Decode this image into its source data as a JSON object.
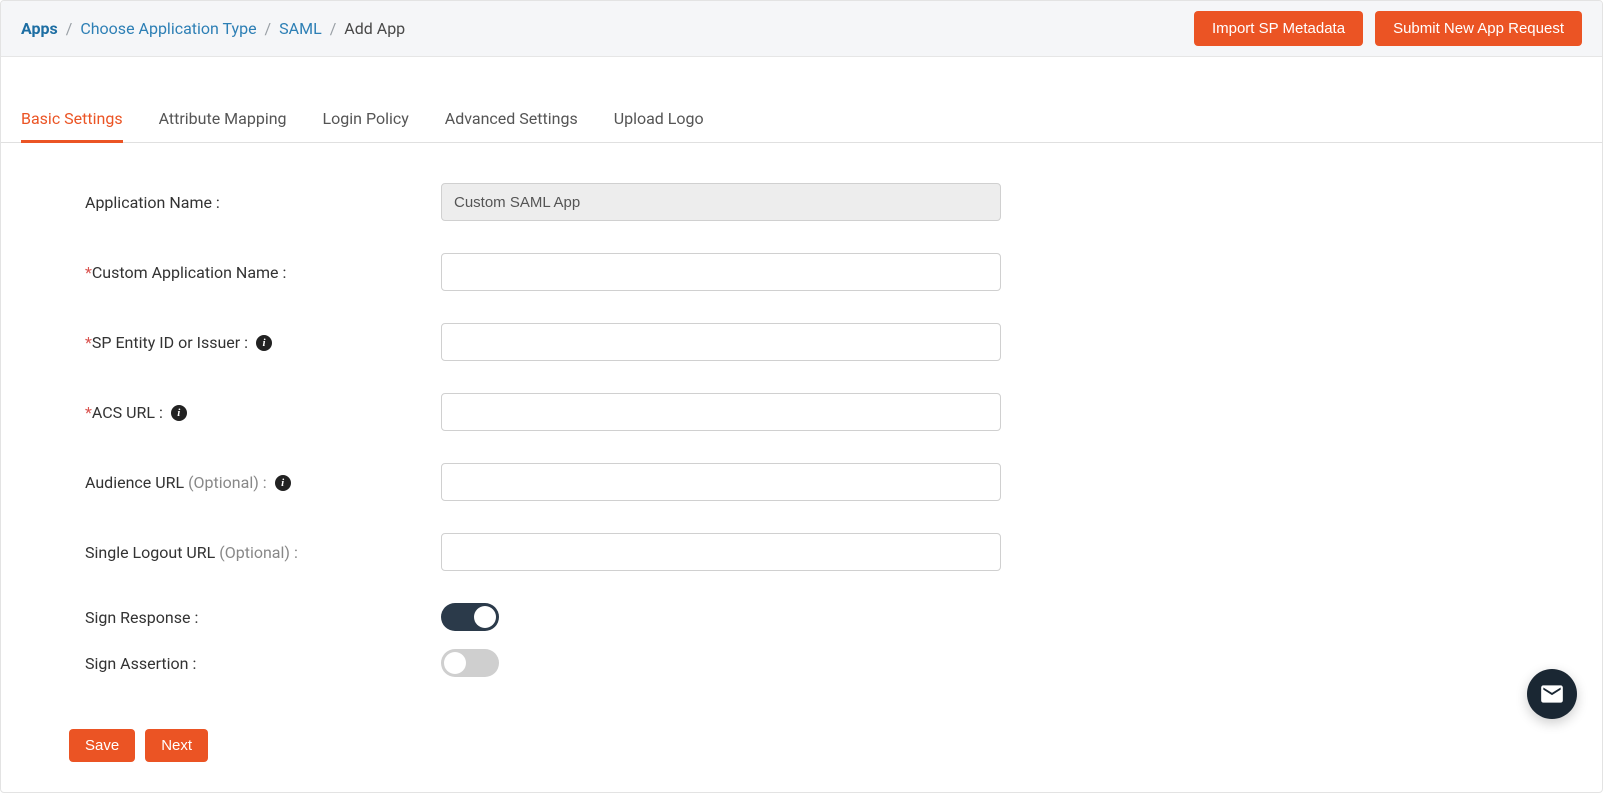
{
  "breadcrumbs": {
    "items": [
      {
        "label": "Apps",
        "strong": true,
        "link": true
      },
      {
        "label": "Choose Application Type",
        "link": true
      },
      {
        "label": "SAML",
        "link": true
      },
      {
        "label": "Add App",
        "link": false
      }
    ]
  },
  "topActions": {
    "import": "Import SP Metadata",
    "submit": "Submit New App Request"
  },
  "tabs": [
    {
      "label": "Basic Settings",
      "active": true
    },
    {
      "label": "Attribute Mapping",
      "active": false
    },
    {
      "label": "Login Policy",
      "active": false
    },
    {
      "label": "Advanced Settings",
      "active": false
    },
    {
      "label": "Upload Logo",
      "active": false
    }
  ],
  "form": {
    "appName": {
      "label": "Application Name :",
      "value": "Custom SAML App"
    },
    "customAppName": {
      "label": "Custom Application Name :",
      "value": ""
    },
    "spEntityId": {
      "label": "SP Entity ID or Issuer :",
      "value": ""
    },
    "acsUrl": {
      "label": "ACS URL :",
      "value": ""
    },
    "audienceUrl": {
      "label": "Audience URL",
      "optional": "(Optional) :",
      "value": ""
    },
    "singleLogoutUrl": {
      "label": "Single Logout URL",
      "optional": "(Optional) :",
      "value": ""
    },
    "signResponse": {
      "label": "Sign Response :",
      "on": true
    },
    "signAssertion": {
      "label": "Sign Assertion :",
      "on": false
    }
  },
  "footer": {
    "save": "Save",
    "next": "Next"
  },
  "icons": {
    "info": "i",
    "mail": "mail-icon"
  }
}
